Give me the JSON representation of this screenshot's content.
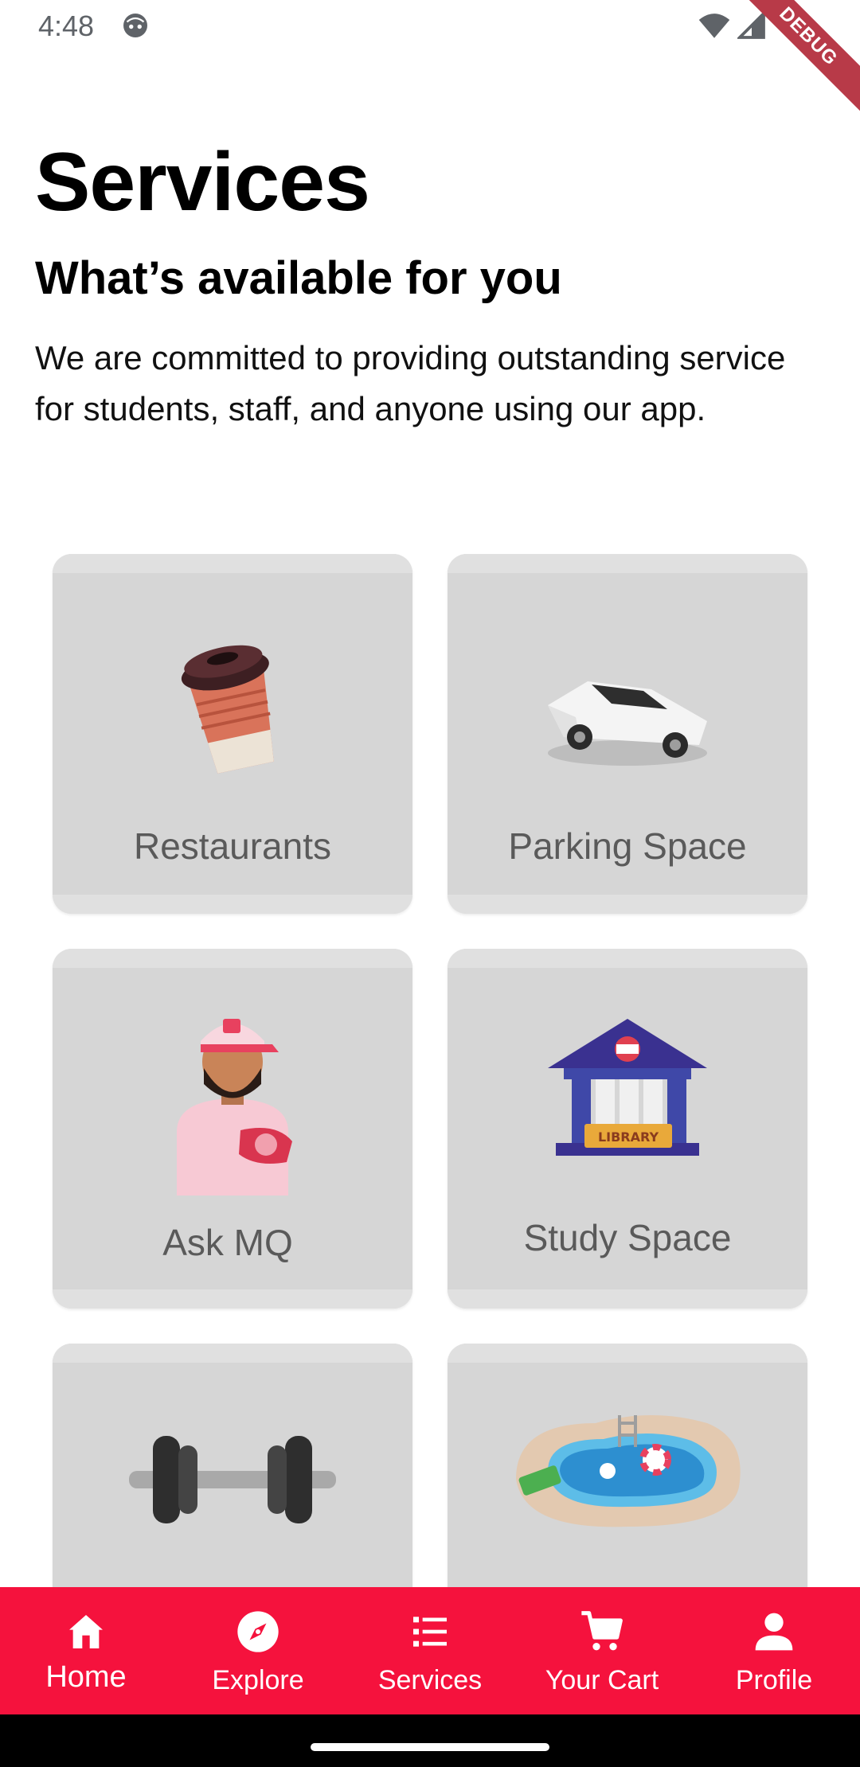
{
  "status_bar": {
    "time": "4:48",
    "debug_label": "DEBUG"
  },
  "header": {
    "title": "Services",
    "subtitle": "What’s available for you",
    "description": "We are committed to providing outstanding service for students, staff, and anyone using our app."
  },
  "services": [
    {
      "label": "Restaurants",
      "icon": "coffee-cup-icon"
    },
    {
      "label": "Parking Space",
      "icon": "car-icon"
    },
    {
      "label": "Ask MQ",
      "icon": "support-person-icon"
    },
    {
      "label": "Study Space",
      "icon": "library-icon"
    },
    {
      "label": "",
      "icon": "dumbbell-icon"
    },
    {
      "label": "",
      "icon": "pool-icon"
    }
  ],
  "bottom_nav": {
    "items": [
      {
        "label": "Home",
        "icon": "home-icon",
        "active": true
      },
      {
        "label": "Explore",
        "icon": "compass-icon"
      },
      {
        "label": "Services",
        "icon": "list-icon"
      },
      {
        "label": "Your Cart",
        "icon": "cart-icon"
      },
      {
        "label": "Profile",
        "icon": "person-icon"
      }
    ]
  },
  "colors": {
    "accent": "#f5123d",
    "card_background": "#d6d6d6",
    "card_label": "#5a5a5a"
  }
}
